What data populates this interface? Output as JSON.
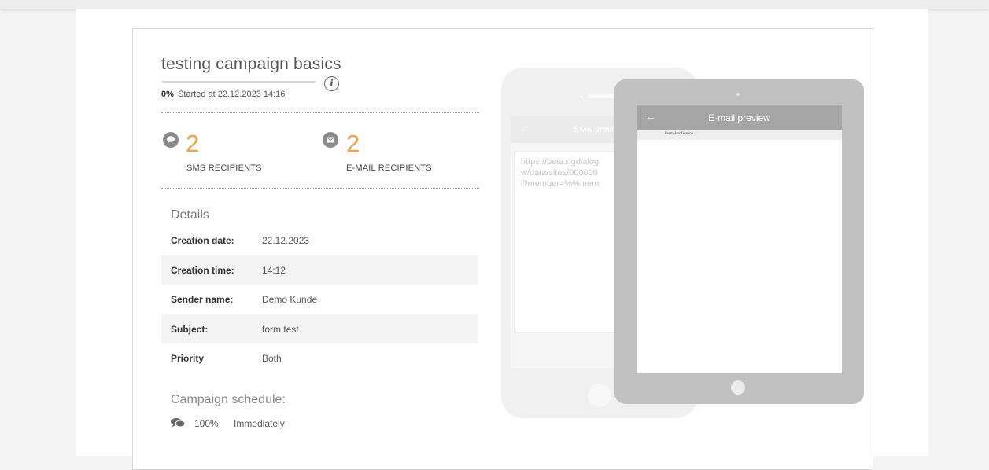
{
  "campaign": {
    "title": "testing campaign basics",
    "progress_percent": 0,
    "progress_label": "0%",
    "started_text": "Started at 22.12.2023 14:16"
  },
  "stats": {
    "sms": {
      "count": "2",
      "label": "SMS RECIPIENTS",
      "icon": "chat-bubble-icon"
    },
    "email": {
      "count": "2",
      "label": "E-MAIL RECIPIENTS",
      "icon": "envelope-icon"
    }
  },
  "details": {
    "heading": "Details",
    "rows": [
      {
        "label": "Creation date:",
        "value": "22.12.2023"
      },
      {
        "label": "Creation time:",
        "value": "14:12"
      },
      {
        "label": "Sender name:",
        "value": "Demo Kunde"
      },
      {
        "label": "Subject:",
        "value": "form test"
      },
      {
        "label": "Priority",
        "value": "Both"
      }
    ]
  },
  "schedule": {
    "heading": "Campaign schedule:",
    "percent": "100%",
    "when": "Immediately"
  },
  "sms_preview": {
    "title": "SMS previ",
    "message": "https://beta.ngdialog\nw/data/sites/000000\nl?member=%%mem"
  },
  "email_preview": {
    "title": "E-mail preview",
    "strip_text": "Form-Verification"
  },
  "colors": {
    "accent": "#f0a04b",
    "tablet_frame": "#c1c1c1",
    "tablet_header": "#a5a5a5"
  }
}
